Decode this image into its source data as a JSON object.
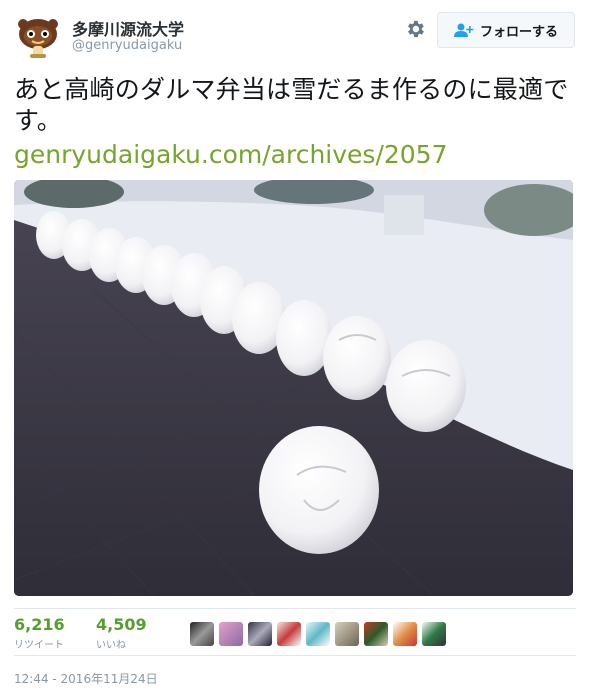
{
  "user": {
    "name": "多摩川源流大学",
    "handle": "@genryudaigaku",
    "avatar_icon": "daruma-mascot-avatar"
  },
  "header": {
    "settings_icon": "gear-icon",
    "follow_label": "フォローする",
    "follow_icon": "add-user-icon"
  },
  "tweet": {
    "text": "あと高崎のダルマ弁当は雪だるま作るのに最適です。",
    "link": "genryudaigaku.com/archives/2057",
    "photo_icon": "snow-daruma-photo"
  },
  "stats": {
    "retweets": "6,216",
    "retweets_label": "リツイート",
    "likes": "4,509",
    "likes_label": "いいね"
  },
  "likers": [
    "avatar-1",
    "avatar-2",
    "avatar-3",
    "avatar-4",
    "avatar-5",
    "avatar-6",
    "avatar-7",
    "avatar-8",
    "avatar-9"
  ],
  "timestamp": "12:44 - 2016年11月24日",
  "colors": {
    "link": "#77a42b",
    "stat_number": "#559e2f",
    "muted": "#8899a6",
    "border": "#e1e8ed"
  }
}
